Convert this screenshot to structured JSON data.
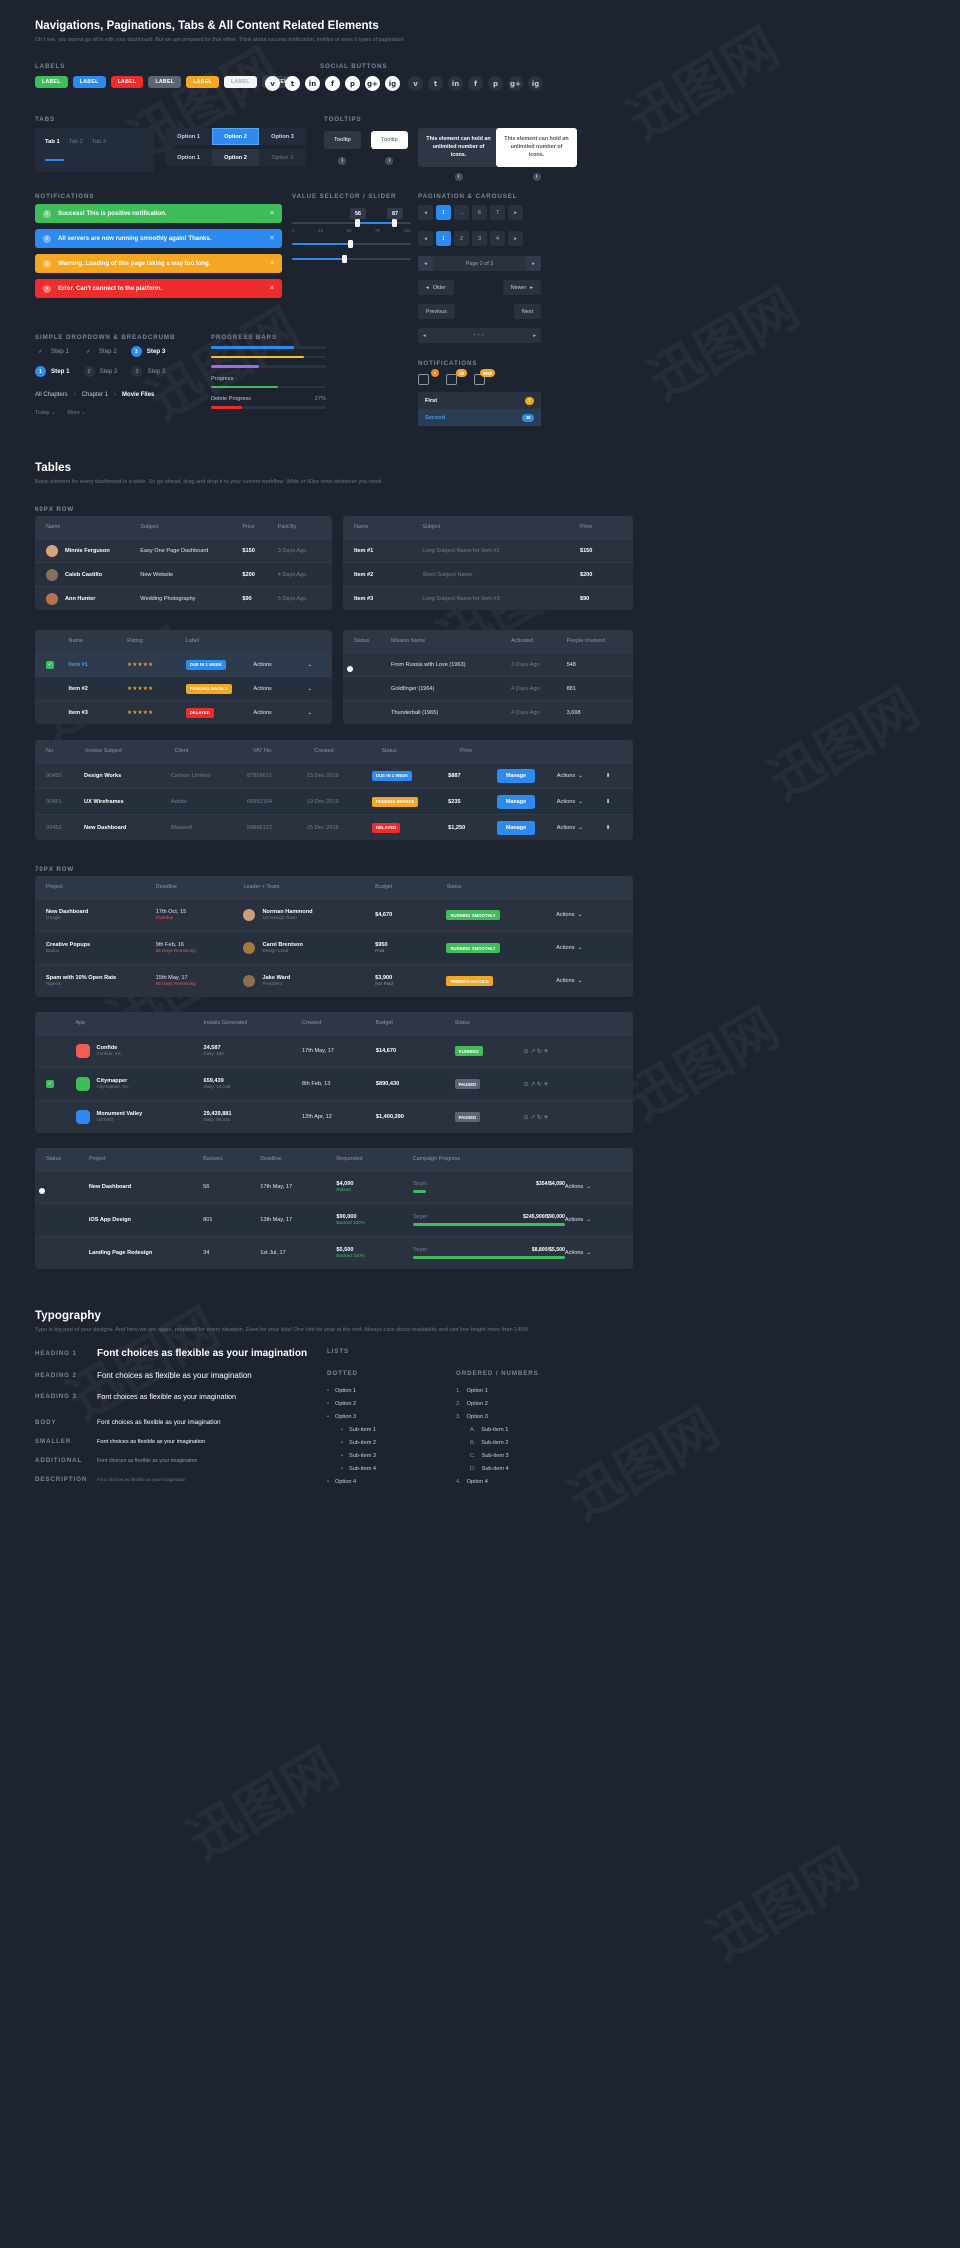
{
  "header": {
    "title": "Navigations, Paginations, Tabs & All Content Related Elements",
    "subtitle": "Oh I see, you wanna go all in with your dashboard. But we are prepared for that either. Think about success notification, tooltips or even 6 types of pagination!"
  },
  "sections": {
    "labels": "LABELS",
    "social": "SOCIAL BUTTONS",
    "tabs": "TABS",
    "tooltips": "TOOLTIPS",
    "notifications": "NOTIFICATIONS",
    "value_selector": "VALUE SELECTOR / SLIDER",
    "pagination": "PAGINATION & CAROUSEL",
    "dropdown": "SIMPLE DROPDOWN & BREADCRUMB",
    "progress": "PROGRESS BARS",
    "notifications2": "NOTIFICATIONS",
    "sixpx": "60PX ROW",
    "toprow": "70PX ROW",
    "lists": "LISTS",
    "dotted": "DOTTED",
    "ordered": "ORDERED / NUMBERS"
  },
  "labels": [
    {
      "text": "LABEL",
      "color": "#3ebd5a",
      "fg": "#ffffff"
    },
    {
      "text": "LABEL",
      "color": "#2d8bef",
      "fg": "#ffffff"
    },
    {
      "text": "LABEL",
      "color": "#f02b2b",
      "fg": "#ffffff"
    },
    {
      "text": "LABEL",
      "color": "#5c6676",
      "fg": "#ffffff"
    },
    {
      "text": "LABEL",
      "color": "#f5a623",
      "fg": "#ffffff"
    },
    {
      "text": "LABEL",
      "color": "#f2f4f7",
      "fg": "#aab2bf"
    },
    {
      "text": "LABEL",
      "color": "#333c4b",
      "fg": "#ffffff"
    }
  ],
  "social_light": [
    "v",
    "t",
    "in",
    "f",
    "p",
    "g+",
    "ig"
  ],
  "social_dark": [
    "v",
    "t",
    "in",
    "f",
    "p",
    "g+",
    "ig"
  ],
  "tabs": {
    "items": [
      "Tab 1",
      "Tab 2",
      "Tab 3"
    ],
    "active": "Tab 1"
  },
  "options": {
    "row1": [
      "Option 1",
      "Option 2",
      "Option 3"
    ],
    "row2": [
      "Option 1",
      "Option 2",
      "Option 3"
    ],
    "selected1": "Option 2",
    "selected2": "Option 2"
  },
  "tooltips": {
    "t1": "Tooltip",
    "t2": "Tooltip",
    "box1": "This element can hold an unlimited number of icons.",
    "box2": "This element can hold an unlimited number of icons."
  },
  "notifications": [
    {
      "text": "Success! This is positive notification.",
      "color": "#3ebd5a",
      "icon": "info-icon"
    },
    {
      "text": "All servers are now running smoothly again! Thanks.",
      "color": "#2d8bef",
      "icon": "info-icon"
    },
    {
      "text": "Warning. Loading of this page taking a way too long.",
      "color": "#f5a623",
      "icon": "info-icon"
    },
    {
      "text": "Error. Can't connect to the platform.",
      "color": "#f02b2b",
      "icon": "error-icon"
    }
  ],
  "slider": {
    "range_low": "56",
    "range_high": "87",
    "ticks": [
      "0",
      "25",
      "50",
      "75",
      "100"
    ],
    "single_value": "",
    "bubble": ""
  },
  "pagination": {
    "row1": [
      "◂",
      "1",
      "...",
      "6",
      "7",
      "▸"
    ],
    "row1_active": "1",
    "row2": [
      "◂",
      "1",
      "2",
      "3",
      "4",
      "▸"
    ],
    "row2_active": "1",
    "page_label": "Page 2 of 3",
    "older": "Older",
    "newer": "Newer",
    "previous": "Previous",
    "next": "Next"
  },
  "steps": {
    "row1": [
      {
        "mark": "✓",
        "label": "Step 1",
        "state": "done"
      },
      {
        "mark": "✓",
        "label": "Step 2",
        "state": "done"
      },
      {
        "mark": "3",
        "label": "Step 3",
        "state": "active"
      }
    ],
    "row2": [
      {
        "mark": "1",
        "label": "Step 1",
        "state": "active"
      },
      {
        "mark": "2",
        "label": "Step 2",
        "state": "idle"
      },
      {
        "mark": "3",
        "label": "Step 3",
        "state": "idle"
      }
    ],
    "breadcrumb": [
      "All Chapters",
      "Chapter 1",
      "Movie Files"
    ],
    "dropdowns": [
      "Today",
      "More"
    ]
  },
  "progress": {
    "bars": [
      {
        "label": "",
        "value": 72,
        "color": "#2d8bef",
        "pct": ""
      },
      {
        "label": "",
        "value": 81,
        "color": "#f5c131",
        "pct": ""
      },
      {
        "label": "",
        "value": 42,
        "color": "#9b6cf0",
        "pct": ""
      },
      {
        "label": "Progress",
        "value": 58,
        "color": "#3ebd5a",
        "pct": ""
      },
      {
        "label": "Delete Progress",
        "value": 27,
        "color": "#f02b2b",
        "pct": "27%"
      }
    ]
  },
  "notif_badges": [
    {
      "icon": "inbox-icon",
      "count": "7",
      "color": "#f5821f"
    },
    {
      "icon": "bell-icon",
      "count": "20",
      "color": "#f5a623"
    },
    {
      "icon": "comment-icon",
      "count": "9999",
      "color": "#f5a623"
    }
  ],
  "notif_list": [
    {
      "label": "First",
      "count": "7",
      "color": "#f5a623",
      "active": false
    },
    {
      "label": "Second",
      "count": "38",
      "color": "#2d8bef",
      "active": true
    }
  ],
  "tables_header": {
    "title": "Tables",
    "subtitle": "Basic element for every dashboard is a table. So go ahead, drag and drop it to your current workflow. Wide or 50px rows whatever you need."
  },
  "table1": {
    "columns": [
      "Name",
      "Subject",
      "Price",
      "Paid By"
    ],
    "rows": [
      {
        "name": "Minnie Ferguson",
        "subject": "Easy One Page Dashboard",
        "price": "$150",
        "paid": "3 Days Ago",
        "av": "#d9a47c"
      },
      {
        "name": "Caleb Castillo",
        "subject": "New Website",
        "price": "$200",
        "paid": "4 Days Ago",
        "av": "#8a6f58"
      },
      {
        "name": "Ann Hunter",
        "subject": "Wedding Photography",
        "price": "$90",
        "paid": "5 Days Ago",
        "av": "#b5744f"
      }
    ]
  },
  "table2": {
    "columns": [
      "Name",
      "Subject",
      "Price"
    ],
    "rows": [
      {
        "name": "Item #1",
        "subject": "Long Subject Name for Item #1",
        "price": "$150"
      },
      {
        "name": "Item #2",
        "subject": "Short Subject Name",
        "price": "$200"
      },
      {
        "name": "Item #3",
        "subject": "Long Subject Name for Item #3",
        "price": "$90"
      }
    ]
  },
  "table3": {
    "columns": [
      "",
      "Name",
      "Rating",
      "Label",
      "",
      ""
    ],
    "rows": [
      {
        "name": "Item #1",
        "stars": "★★★★★",
        "tag": "DUE IN 1 WEEK",
        "tagcolor": "#2d8bef",
        "actions": "Actions",
        "checked": true,
        "highlight": true
      },
      {
        "name": "Item #2",
        "stars": "★★★★★",
        "tag": "PENDING INVOICE",
        "tagcolor": "#f5a623",
        "actions": "Actions",
        "checked": false,
        "highlight": false
      },
      {
        "name": "Item #3",
        "stars": "★★★★★",
        "tag": "DELAYED",
        "tagcolor": "#f02b2b",
        "actions": "Actions",
        "checked": false,
        "highlight": false
      }
    ]
  },
  "table4": {
    "columns": [
      "Status",
      "Mission Name",
      "Activated",
      "People Involved"
    ],
    "rows": [
      {
        "mission": "From Russia with Love (1963)",
        "activated": "3 Days Ago",
        "people": "548",
        "toggle": true
      },
      {
        "mission": "Goldfinger (1964)",
        "activated": "4 Days Ago",
        "people": "881",
        "toggle": false
      },
      {
        "mission": "Thunderball (1965)",
        "activated": "4 Days Ago",
        "people": "3,698",
        "toggle": false
      }
    ]
  },
  "table5": {
    "columns": [
      "No.",
      "Invoice Subject",
      "Client",
      "VAT No.",
      "Created",
      "Status",
      "Price",
      "",
      ""
    ],
    "rows": [
      {
        "no": "00450",
        "subject": "Design Works",
        "client": "Carlson Limited",
        "vat": "87956621",
        "created": "15 Dec 2016",
        "status": "DUE IN 1 WEEK",
        "statuscolor": "#2d8bef",
        "price": "$887",
        "manage": "Manage",
        "actions": "Actions"
      },
      {
        "no": "00451",
        "subject": "UX Wireframes",
        "client": "Adobe",
        "vat": "68952154",
        "created": "19 Dec 2016",
        "status": "PENDING INVOICE",
        "statuscolor": "#f5a623",
        "price": "$235",
        "manage": "Manage",
        "actions": "Actions"
      },
      {
        "no": "00452",
        "subject": "New Dashboard",
        "client": "Bluewolf",
        "vat": "59866122",
        "created": "25 Dec 2016",
        "status": "DELAYED",
        "statuscolor": "#f02b2b",
        "price": "$1,250",
        "manage": "Manage",
        "actions": "Actions"
      }
    ]
  },
  "table6": {
    "columns": [
      "Project",
      "Deadline",
      "Leader + Team",
      "Budget",
      "Status",
      ""
    ],
    "rows": [
      {
        "project": "New Dashboard",
        "sub": "Google",
        "deadline": "17th Oct, 15",
        "dsub": "Overdue",
        "leader": "Norman Hammond",
        "lsub": "UX Design Team",
        "budget": "$4,670",
        "status": "RUNNING SMOOTHLY",
        "statuscolor": "#3ebd5a",
        "actions": "Actions",
        "av": "#c9a07a"
      },
      {
        "project": "Creative Popups",
        "sub": "Badoo",
        "deadline": "9th Feb, 16",
        "dsub": "65 Days Remaining",
        "leader": "Carol Brentson",
        "lsub": "Design Lead",
        "budget": "$950",
        "bsub": "Paid",
        "status": "RUNNING SMOOTHLY",
        "statuscolor": "#3ebd5a",
        "actions": "Actions",
        "av": "#a8763f"
      },
      {
        "project": "Spam with 10% Open Rate",
        "sub": "Nigeria",
        "deadline": "15th May, 17",
        "dsub": "65 Days Remaining",
        "leader": "Jake Ward",
        "lsub": "President",
        "budget": "$3,900",
        "bsub": "Not Paid",
        "status": "PENDING INVOICE",
        "statuscolor": "#f5a623",
        "actions": "Actions",
        "av": "#8f6d53"
      }
    ]
  },
  "table7": {
    "columns": [
      "",
      "App",
      "Installs Generated",
      "Created",
      "Budget",
      "Status",
      ""
    ],
    "rows": [
      {
        "app": "Confide",
        "appsub": "Confide, Inc.",
        "installs": "24,587",
        "isub": "Daily: 690",
        "created": "17th May, 17",
        "budget": "$14,670",
        "status": "RUNNING",
        "statuscolor": "#3ebd5a",
        "icon": "#f25c54",
        "checked": false
      },
      {
        "app": "Citymapper",
        "appsub": "Citymapper, Inc.",
        "installs": "659,439",
        "isub": "Daily: 14,196",
        "created": "8th Feb, 13",
        "budget": "$890,430",
        "status": "PAUSED",
        "statuscolor": "#5c6676",
        "icon": "#3ebd5a",
        "checked": true
      },
      {
        "app": "Monument Valley",
        "appsub": "USTWO",
        "installs": "29,439,881",
        "isub": "Daily: 98,441",
        "created": "12th Apr, 12",
        "budget": "$1,400,390",
        "status": "PAUSED",
        "statuscolor": "#5c6676",
        "icon": "#2d8bef",
        "checked": false
      }
    ]
  },
  "table8": {
    "columns": [
      "Status",
      "Project",
      "Backers",
      "Deadline",
      "Requested",
      "Campaign Progress",
      ""
    ],
    "rows": [
      {
        "project": "New Dashboard",
        "backers": "56",
        "deadline": "17th May, 17",
        "requested": "$4,090",
        "rsub": "Raised",
        "target": "Target",
        "amount": "$354/$4,090",
        "progress": 9,
        "pcolor": "#3ebd5a",
        "toggle": true,
        "actions": "Actions"
      },
      {
        "project": "iOS App Design",
        "backers": "801",
        "deadline": "13th May, 17",
        "requested": "$90,000",
        "rsub": "Backed 100%",
        "target": "Target",
        "amount": "$245,900/$90,000",
        "progress": 100,
        "pcolor": "#3ebd5a",
        "toggle": false,
        "actions": "Actions"
      },
      {
        "project": "Landing Page Redesign",
        "backers": "34",
        "deadline": "1st Jul, 17",
        "requested": "$5,500",
        "rsub": "Backed 100%",
        "target": "Target",
        "amount": "$8,800/$5,500",
        "progress": 100,
        "pcolor": "#3ebd5a",
        "toggle": false,
        "actions": "Actions"
      }
    ]
  },
  "typography": {
    "title": "Typography",
    "subtitle": "Typo is big part of your designs. And here we are again, prepared for every situation. Even for your lists! One hint for year at the end: Always care about readability and use line-height more than 140%",
    "rows": [
      {
        "label": "HEADING 1",
        "text": "Font choices as flexible as your imagination"
      },
      {
        "label": "HEADING 2",
        "text": "Font choices as flexible as your imagination"
      },
      {
        "label": "HEADING 3",
        "text": "Font choices as flexible as your imagination"
      },
      {
        "label": "BODY",
        "text": "Font choices as flexible as your imagination"
      },
      {
        "label": "SMALLER",
        "text": "Font choices as flexible as your imagination"
      },
      {
        "label": "ADDITIONAL",
        "text": "Font choices as flexible as your imagination"
      },
      {
        "label": "DESCRIPTION",
        "text": "Font choices as flexible as your imagination"
      }
    ],
    "dotted": [
      {
        "text": "Option 1",
        "sub": false
      },
      {
        "text": "Option 2",
        "sub": false
      },
      {
        "text": "Option 3",
        "sub": false
      },
      {
        "text": "Sub-item 1",
        "sub": true
      },
      {
        "text": "Sub-item 2",
        "sub": true
      },
      {
        "text": "Sub-item 3",
        "sub": true
      },
      {
        "text": "Sub-item 4",
        "sub": true
      },
      {
        "text": "Option 4",
        "sub": false
      }
    ],
    "ordered": [
      {
        "text": "Option 1",
        "mark": "1.",
        "sub": false
      },
      {
        "text": "Option 2",
        "mark": "2.",
        "sub": false
      },
      {
        "text": "Option 3",
        "mark": "3.",
        "sub": false
      },
      {
        "text": "Sub-item 1",
        "mark": "A.",
        "sub": true
      },
      {
        "text": "Sub-item 2",
        "mark": "B.",
        "sub": true
      },
      {
        "text": "Sub-item 3",
        "mark": "C.",
        "sub": true
      },
      {
        "text": "Sub-item 4",
        "mark": "D.",
        "sub": true
      },
      {
        "text": "Option 4",
        "mark": "4.",
        "sub": false
      }
    ]
  }
}
